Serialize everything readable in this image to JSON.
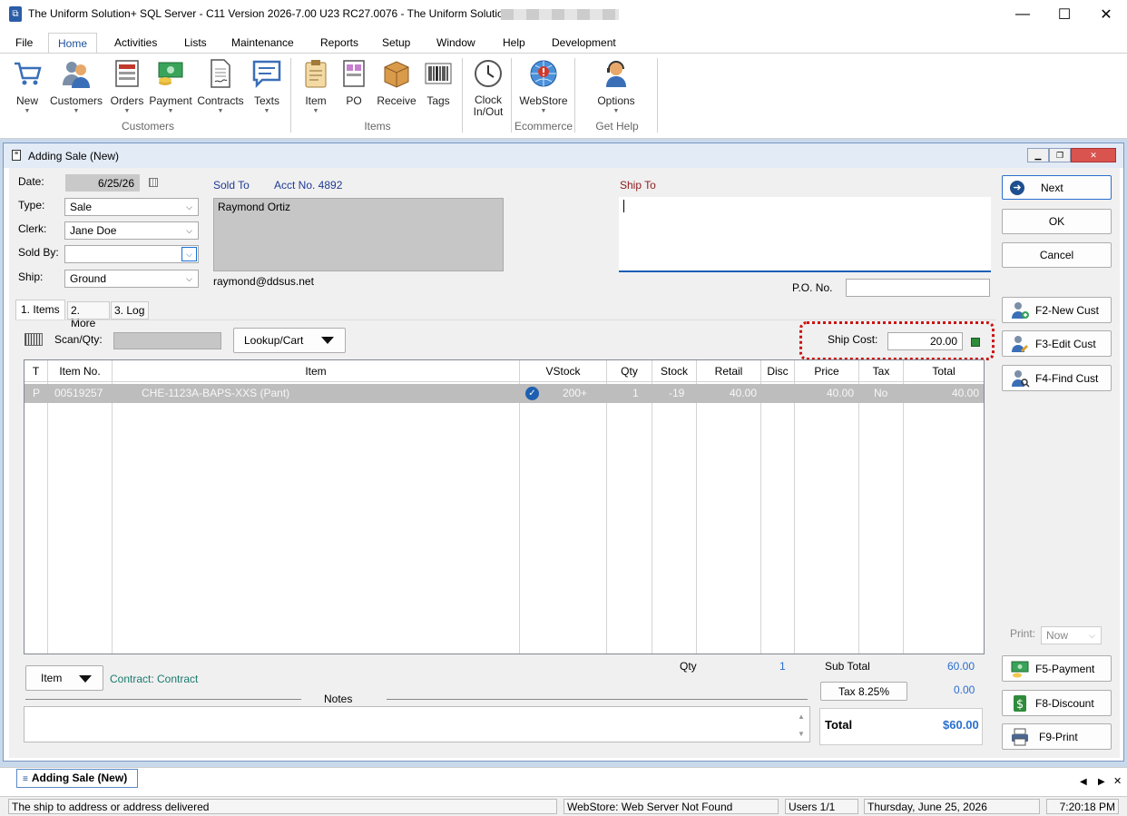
{
  "app": {
    "title": "The Uniform Solution+ SQL Server - C11 Version 2026-7.00 U23 RC27.0076 - The Uniform Solution"
  },
  "menu": [
    "File",
    "Home",
    "Activities",
    "Lists",
    "Maintenance",
    "Reports",
    "Setup",
    "Window",
    "Help",
    "Development"
  ],
  "ribbon": {
    "new": "New",
    "customers": "Customers",
    "orders": "Orders",
    "payment": "Payment",
    "contracts": "Contracts",
    "texts": "Texts",
    "item": "Item",
    "po": "PO",
    "receive": "Receive",
    "tags": "Tags",
    "clock_line1": "Clock",
    "clock_line2": "In/Out",
    "webstore": "WebStore",
    "options": "Options",
    "groups": {
      "customers": "Customers",
      "items": "Items",
      "ecommerce": "Ecommerce",
      "gethelp": "Get Help"
    }
  },
  "window": {
    "title": "Adding Sale  (New)"
  },
  "form": {
    "date_label": "Date:",
    "date_value": "6/25/26",
    "type_label": "Type:",
    "type_value": "Sale",
    "clerk_label": "Clerk:",
    "clerk_value": "Jane Doe",
    "soldby_label": "Sold By:",
    "soldby_value": "",
    "ship_label": "Ship:",
    "ship_value": "Ground",
    "sold_to_label": "Sold To",
    "acct_label": "Acct No. 4892",
    "customer_name": "Raymond Ortiz",
    "customer_email": "raymond@ddsus.net",
    "ship_to_label": "Ship To",
    "po_label": "P.O. No.",
    "po_value": "",
    "tabs": [
      "1. Items",
      "2. More",
      "3. Log"
    ],
    "scan_label": "Scan/Qty:",
    "lookup_label": "Lookup/Cart",
    "ship_cost_label": "Ship Cost:",
    "ship_cost_value": "20.00",
    "item_dropdown": "Item",
    "contract_text": "Contract: Contract",
    "notes_label": "Notes",
    "qty_label": "Qty",
    "qty_value": "1",
    "subtotal_label": "Sub Total",
    "subtotal_value": "60.00",
    "tax_label": "Tax  8.25%",
    "tax_value": "0.00",
    "total_label": "Total",
    "total_value": "$60.00",
    "print_label": "Print:",
    "print_value": "Now"
  },
  "grid": {
    "columns": [
      "T",
      "Item No.",
      "Item",
      "VStock",
      "Qty",
      "Stock",
      "Retail",
      "Disc",
      "Price",
      "Tax",
      "Total"
    ],
    "rows": [
      {
        "t": "P",
        "item_no": "00519257",
        "item": "CHE-1123A-BAPS-XXS  (Pant)",
        "vstock": "200+",
        "qty": "1",
        "stock": "-19",
        "retail": "40.00",
        "disc": "",
        "price": "40.00",
        "tax": "No",
        "total": "40.00"
      }
    ]
  },
  "buttons": {
    "next": "Next",
    "ok": "OK",
    "cancel": "Cancel",
    "f2": "F2-New Cust",
    "f3": "F3-Edit Cust",
    "f4": "F4-Find Cust",
    "f5": "F5-Payment",
    "f8": "F8-Discount",
    "f9": "F9-Print"
  },
  "taskbar": {
    "tab": "Adding Sale  (New)"
  },
  "status": {
    "hint": "The ship to address or address delivered",
    "webstore": "WebStore: Web Server Not Found",
    "users": "Users 1/1",
    "date": "Thursday, June 25, 2026",
    "time": "7:20:18 PM"
  },
  "colors": {
    "accent": "#1a4f9e",
    "highlight_border": "#cc0000",
    "row_selected": "#bdbdbd"
  }
}
